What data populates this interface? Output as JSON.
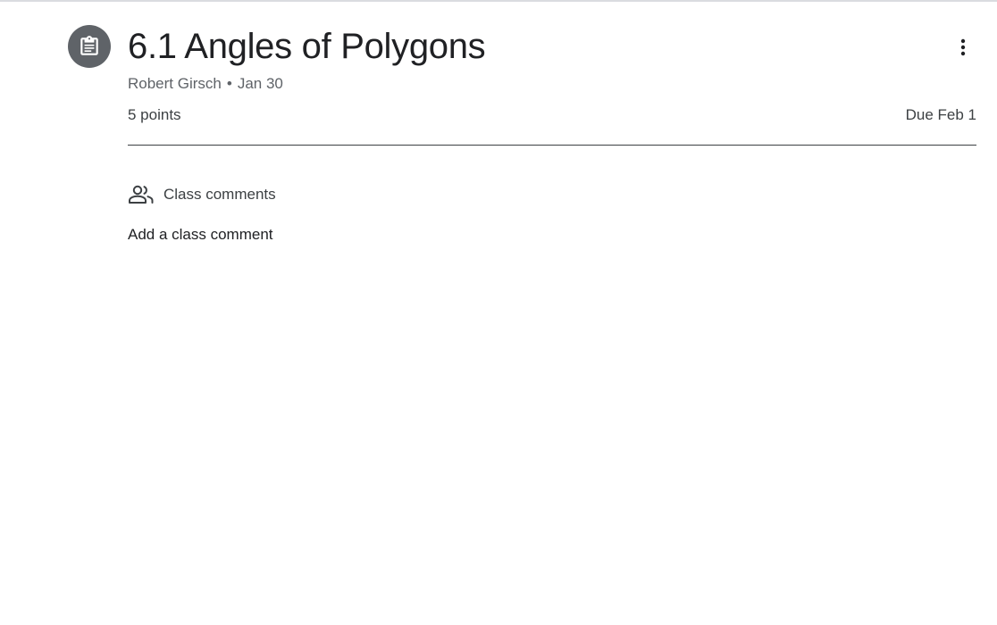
{
  "assignment": {
    "icon": "assignment-icon",
    "title": "6.1 Angles of Polygons",
    "author": "Robert Girsch",
    "separator": "•",
    "posted_date": "Jan 30",
    "points": "5 points",
    "due": "Due Feb 1",
    "more_icon": "more-vert-icon"
  },
  "comments": {
    "icon": "people-icon",
    "header_label": "Class comments",
    "add_label": "Add a class comment"
  },
  "colors": {
    "icon_circle": "#5f6368",
    "title_text": "#202124",
    "secondary_text": "#5f6368",
    "divider": "#3c4043"
  }
}
